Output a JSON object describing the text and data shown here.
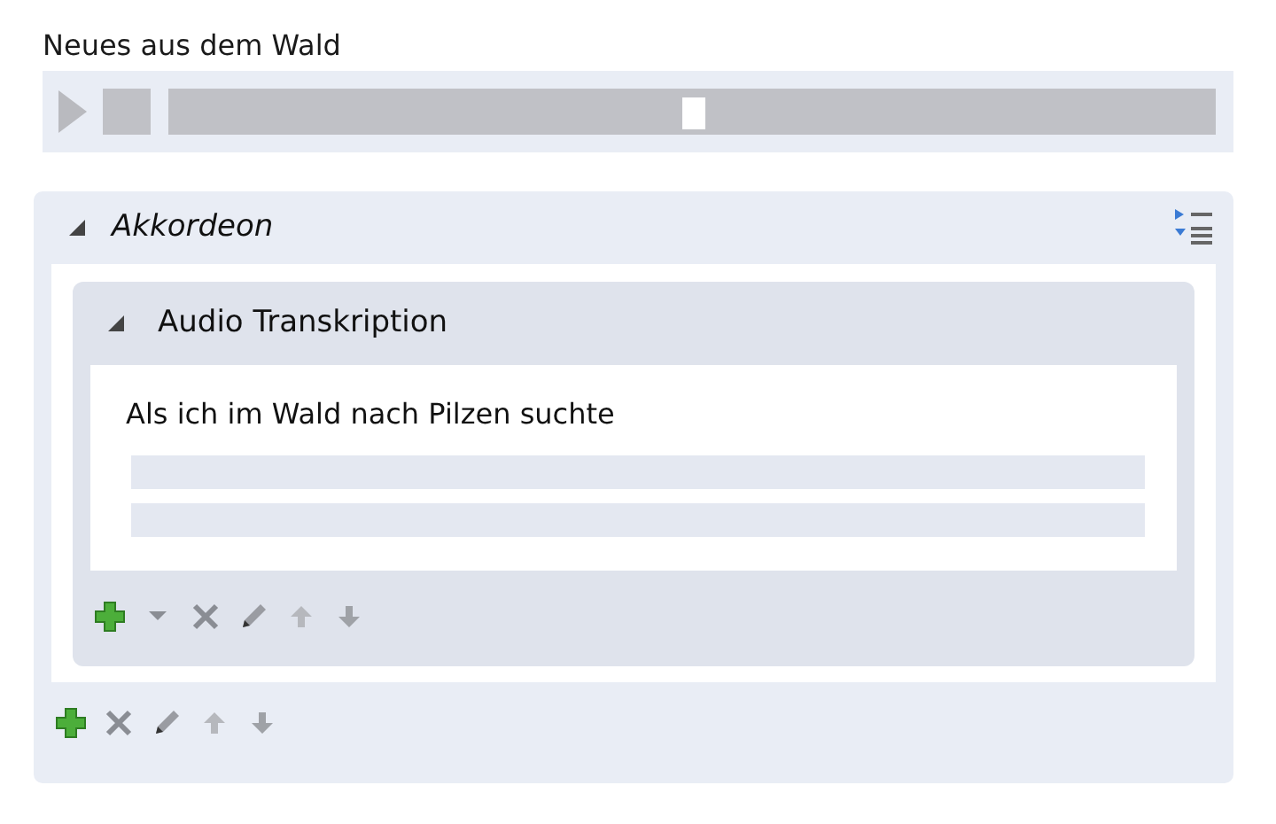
{
  "title": "Neues aus dem Wald",
  "player": {
    "playing": false,
    "level": 0.5
  },
  "accordion": {
    "title": "Akkordeon",
    "expanded": true,
    "panel": {
      "title": "Audio Transkription",
      "expanded": true,
      "text": "Als ich im Wald nach Pilzen suchte",
      "tools": [
        {
          "kind": "add"
        },
        {
          "kind": "dropdown"
        },
        {
          "kind": "delete"
        },
        {
          "kind": "edit"
        },
        {
          "kind": "up"
        },
        {
          "kind": "down"
        }
      ]
    },
    "tools": [
      {
        "kind": "add"
      },
      {
        "kind": "delete"
      },
      {
        "kind": "edit"
      },
      {
        "kind": "up"
      },
      {
        "kind": "down"
      }
    ]
  }
}
